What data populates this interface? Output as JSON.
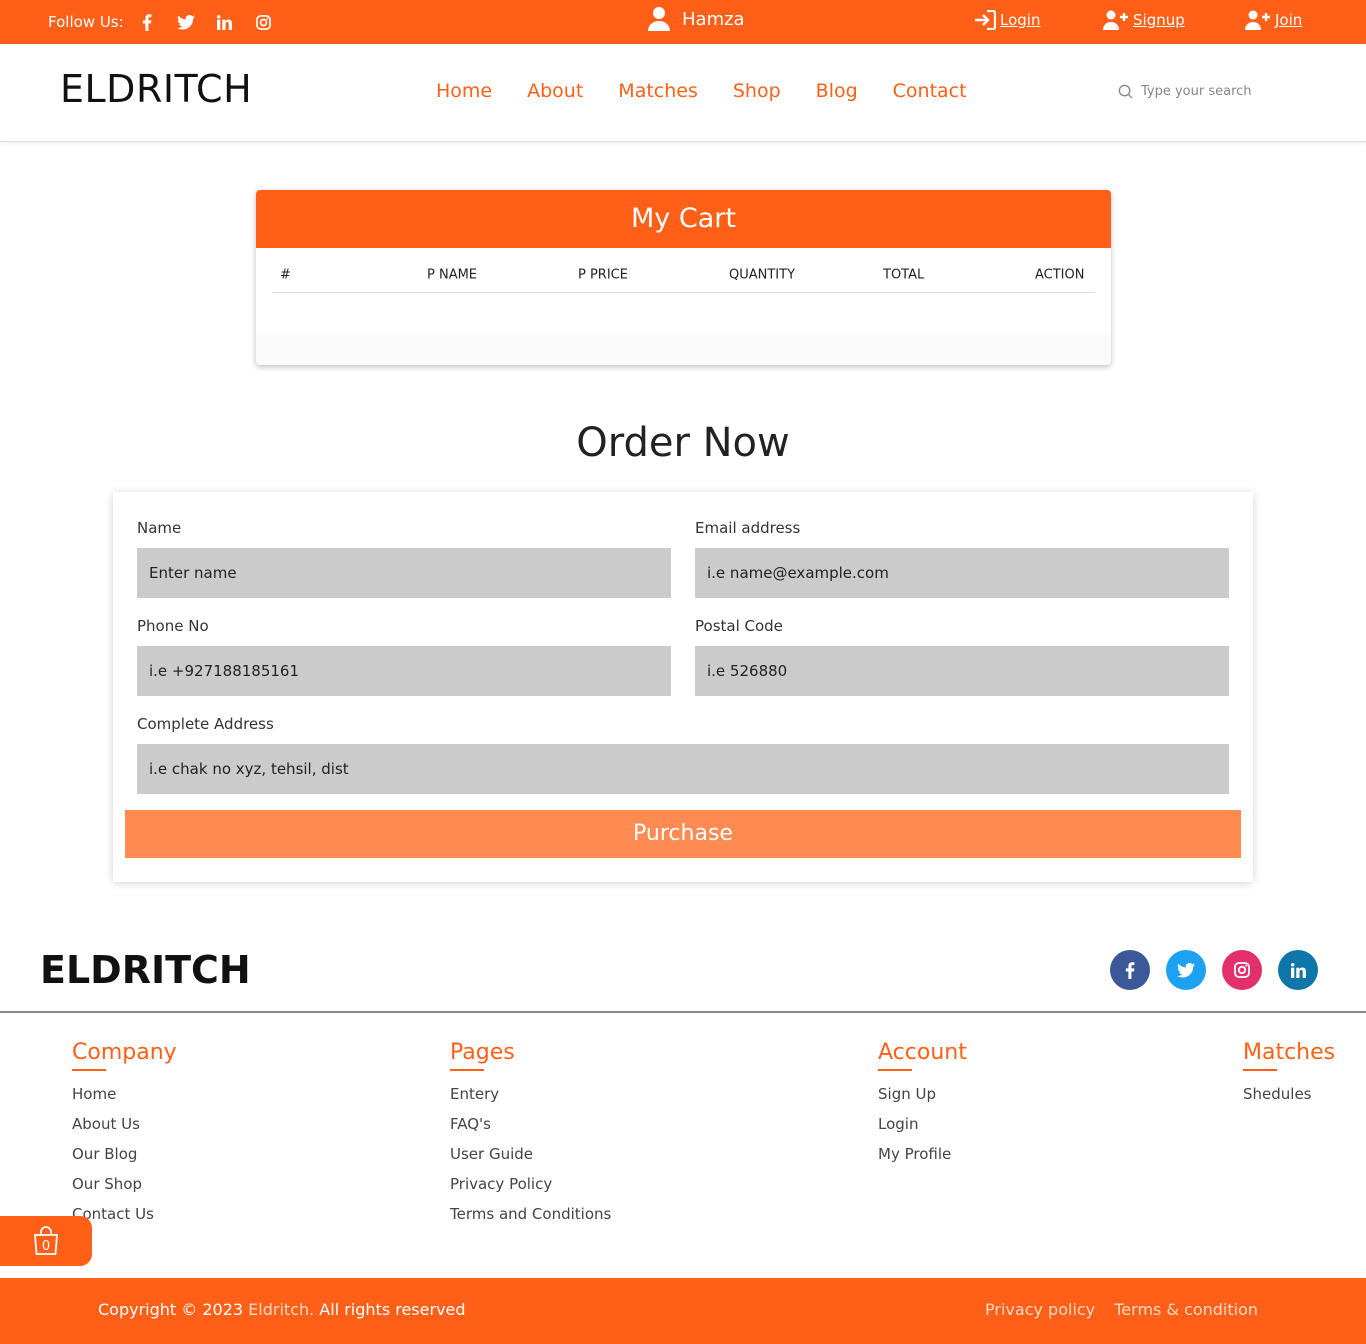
{
  "topbar": {
    "follow_label": "Follow Us:",
    "social_icons": [
      "facebook-icon",
      "twitter-icon",
      "linkedin-icon",
      "instagram-icon"
    ],
    "user_name": "Hamza",
    "login": "Login",
    "signup": "Signup",
    "join": "Join"
  },
  "header": {
    "logo": "ELDRITCH",
    "nav": [
      "Home",
      "About",
      "Matches",
      "Shop",
      "Blog",
      "Contact"
    ],
    "search_placeholder": "Type your search"
  },
  "cart": {
    "title": "My Cart",
    "columns": [
      "#",
      "P NAME",
      "P PRICE",
      "QUANTITY",
      "TOTAL",
      "ACTION"
    ]
  },
  "order": {
    "title": "Order Now",
    "fields": {
      "name": {
        "label": "Name",
        "placeholder": "Enter name"
      },
      "email": {
        "label": "Email address",
        "placeholder": "i.e name@example.com"
      },
      "phone": {
        "label": "Phone No",
        "placeholder": "i.e +927188185161"
      },
      "postal": {
        "label": "Postal Code",
        "placeholder": "i.e 526880"
      },
      "address": {
        "label": "Complete Address",
        "placeholder": "i.e chak no xyz, tehsil, dist"
      }
    },
    "purchase_label": "Purchase"
  },
  "footer": {
    "logo": "ELDRITCH",
    "social_icons": [
      "facebook-icon",
      "twitter-icon",
      "instagram-icon",
      "linkedin-icon"
    ],
    "columns": [
      {
        "title": "Company",
        "items": [
          "Home",
          "About Us",
          "Our Blog",
          "Our Shop",
          "Contact Us"
        ]
      },
      {
        "title": "Pages",
        "items": [
          "Entery",
          "FAQ's",
          "User Guide",
          "Privacy Policy",
          "Terms and Conditions"
        ]
      },
      {
        "title": "Account",
        "items": [
          "Sign Up",
          "Login",
          "My Profile"
        ]
      },
      {
        "title": "Matches",
        "items": [
          "Shedules"
        ]
      }
    ],
    "cart_count": "0",
    "copyright_prefix": "Copyright © 2023",
    "copyright_brand": "Eldritch.",
    "copyright_suffix": "All rights reserved",
    "privacy": "Privacy policy",
    "terms": "Terms & condition"
  },
  "colors": {
    "accent": "#ff5f17",
    "purchase_button": "#ff8a52",
    "input_bg": "#cbcbcb",
    "facebook": "#3b5998",
    "twitter": "#1da1f2",
    "instagram": "#e1306c",
    "linkedin": "#0e76a8"
  }
}
